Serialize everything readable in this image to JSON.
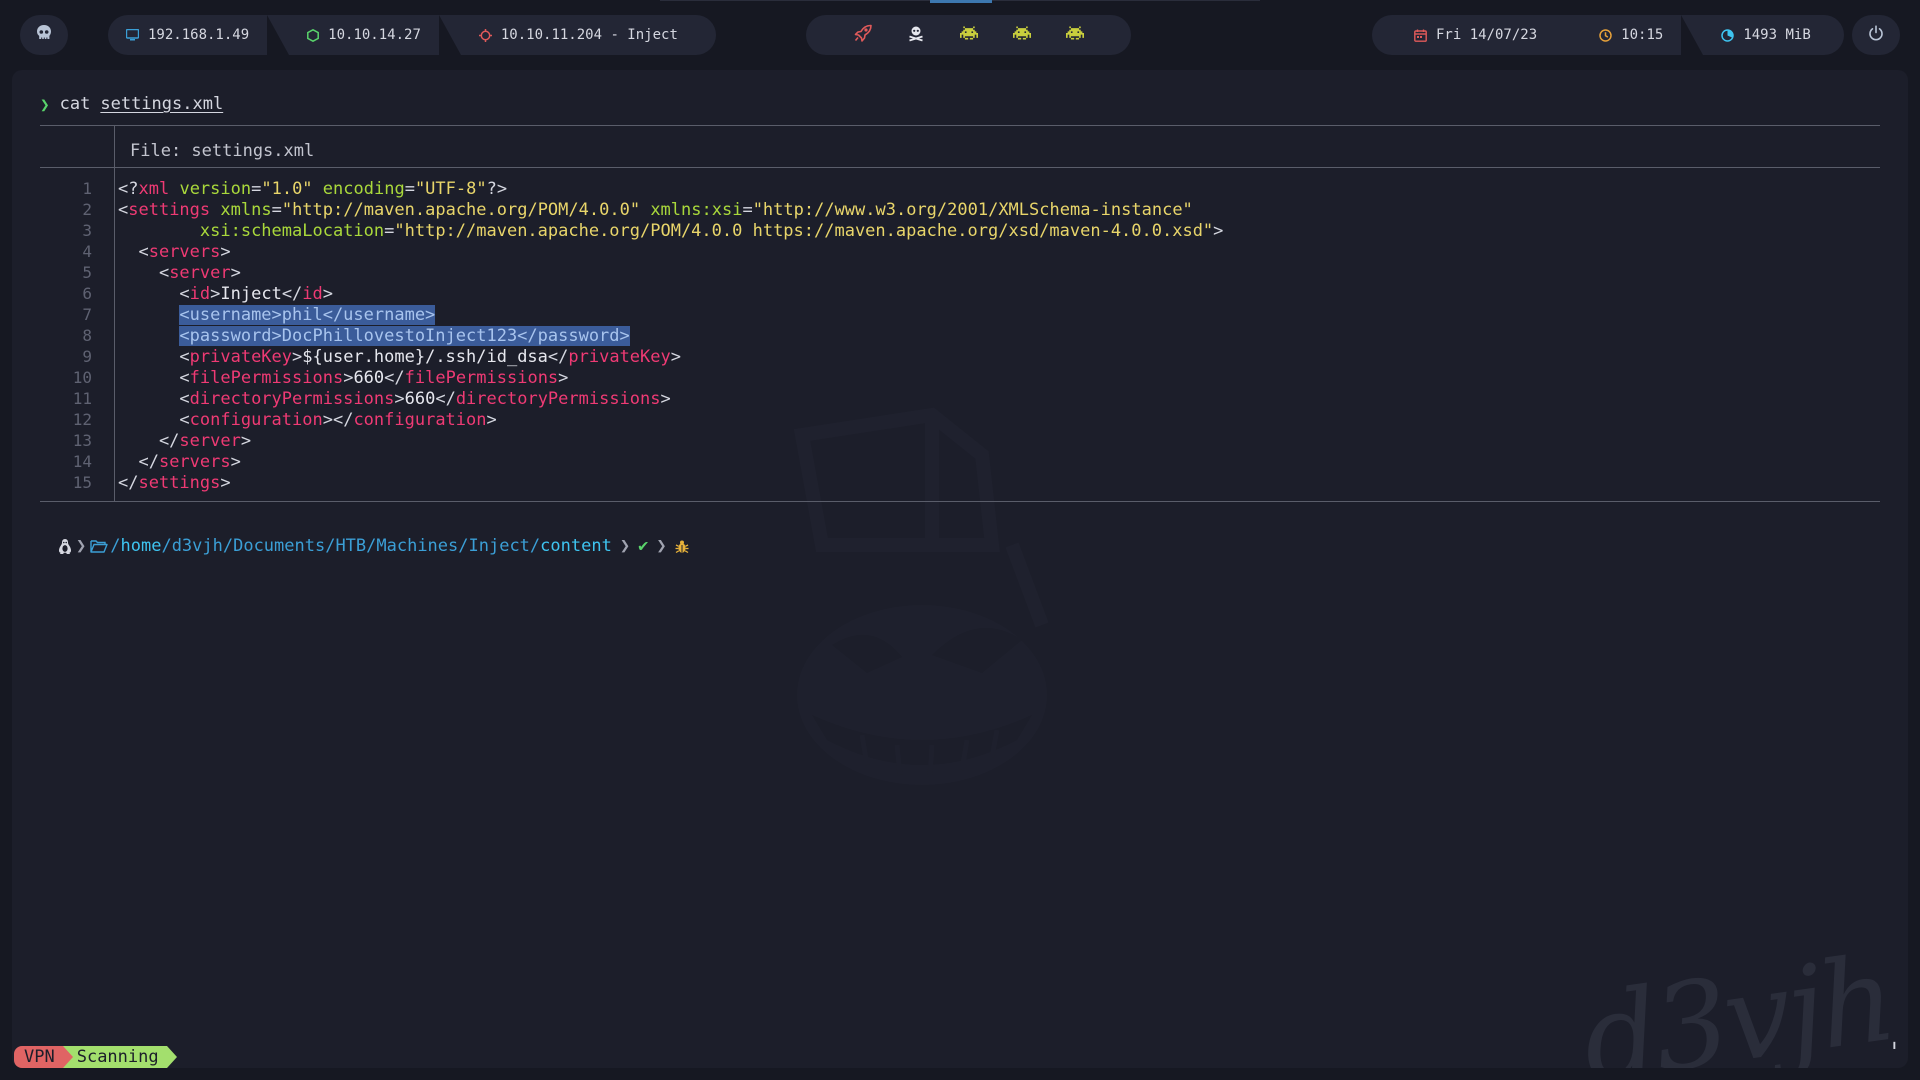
{
  "topbar": {
    "network": [
      {
        "icon": "monitor-icon",
        "label": "192.168.1.49",
        "color": "#3b9fd6"
      },
      {
        "icon": "hexagon-icon",
        "label": "10.10.14.27",
        "color": "#59d36b"
      },
      {
        "icon": "crosshair-icon",
        "label": "10.10.11.204 - Inject",
        "color": "#e05a5a"
      }
    ],
    "workspaces": [
      {
        "icon": "rocket-icon",
        "color": "#e05a5a"
      },
      {
        "icon": "skull-crossbones-icon",
        "color": "#e6e7ee"
      },
      {
        "icon": "space-invader-icon",
        "color": "#c9cf3d"
      },
      {
        "icon": "space-invader-icon",
        "color": "#c9cf3d"
      },
      {
        "icon": "space-invader-icon",
        "color": "#c9cf3d"
      }
    ],
    "info": [
      {
        "icon": "calendar-icon",
        "label": "Fri 14/07/23",
        "color": "#e05a5a"
      },
      {
        "icon": "clock-icon",
        "label": "10:15",
        "color": "#e6a13a"
      },
      {
        "icon": "memory-icon",
        "label": "1493 MiB",
        "color": "#3ec4f0"
      }
    ]
  },
  "terminal": {
    "command": {
      "name": "cat",
      "arg": "settings.xml"
    },
    "file_header": "File: settings.xml",
    "lines": [
      {
        "n": "1",
        "tokens": [
          [
            "t-pun",
            "<?"
          ],
          [
            "t-tag",
            "xml"
          ],
          [
            "t-pun",
            " "
          ],
          [
            "t-attr",
            "version"
          ],
          [
            "t-pun",
            "="
          ],
          [
            "t-str",
            "\"1.0\""
          ],
          [
            "t-pun",
            " "
          ],
          [
            "t-attr",
            "encoding"
          ],
          [
            "t-pun",
            "="
          ],
          [
            "t-str",
            "\"UTF-8\""
          ],
          [
            "t-pun",
            "?>"
          ]
        ]
      },
      {
        "n": "2",
        "tokens": [
          [
            "t-pun",
            "<"
          ],
          [
            "t-tag",
            "settings"
          ],
          [
            "t-pun",
            " "
          ],
          [
            "t-attr",
            "xmlns"
          ],
          [
            "t-pun",
            "="
          ],
          [
            "t-str",
            "\"http://maven.apache.org/POM/4.0.0\""
          ],
          [
            "t-pun",
            " "
          ],
          [
            "t-attr",
            "xmlns:xsi"
          ],
          [
            "t-pun",
            "="
          ],
          [
            "t-str",
            "\"http://www.w3.org/2001/XMLSchema-instance\""
          ]
        ]
      },
      {
        "n": "3",
        "tokens": [
          [
            "t-pun",
            "        "
          ],
          [
            "t-attr",
            "xsi:schemaLocation"
          ],
          [
            "t-pun",
            "="
          ],
          [
            "t-str",
            "\"http://maven.apache.org/POM/4.0.0 https://maven.apache.org/xsd/maven-4.0.0.xsd\""
          ],
          [
            "t-pun",
            ">"
          ]
        ]
      },
      {
        "n": "4",
        "tokens": [
          [
            "t-pun",
            "  <"
          ],
          [
            "t-tag",
            "servers"
          ],
          [
            "t-pun",
            ">"
          ]
        ]
      },
      {
        "n": "5",
        "tokens": [
          [
            "t-pun",
            "    <"
          ],
          [
            "t-tag",
            "server"
          ],
          [
            "t-pun",
            ">"
          ]
        ]
      },
      {
        "n": "6",
        "tokens": [
          [
            "t-pun",
            "      <"
          ],
          [
            "t-tag",
            "id"
          ],
          [
            "t-pun",
            ">"
          ],
          [
            "t-txt",
            "Inject"
          ],
          [
            "t-pun",
            "</"
          ],
          [
            "t-tag",
            "id"
          ],
          [
            "t-pun",
            ">"
          ]
        ]
      },
      {
        "n": "7",
        "tokens": [
          [
            "t-pun",
            "      "
          ],
          [
            "hl",
            "<username>phil</username>"
          ]
        ]
      },
      {
        "n": "8",
        "tokens": [
          [
            "t-pun",
            "      "
          ],
          [
            "hl",
            "<password>DocPhillovestoInject123</password>"
          ]
        ]
      },
      {
        "n": "9",
        "tokens": [
          [
            "t-pun",
            "      <"
          ],
          [
            "t-tag",
            "privateKey"
          ],
          [
            "t-pun",
            ">"
          ],
          [
            "t-txt",
            "${user.home}/.ssh/id_dsa"
          ],
          [
            "t-pun",
            "</"
          ],
          [
            "t-tag",
            "privateKey"
          ],
          [
            "t-pun",
            ">"
          ]
        ]
      },
      {
        "n": "10",
        "tokens": [
          [
            "t-pun",
            "      <"
          ],
          [
            "t-tag",
            "filePermissions"
          ],
          [
            "t-pun",
            ">"
          ],
          [
            "t-txt",
            "660"
          ],
          [
            "t-pun",
            "</"
          ],
          [
            "t-tag",
            "filePermissions"
          ],
          [
            "t-pun",
            ">"
          ]
        ]
      },
      {
        "n": "11",
        "tokens": [
          [
            "t-pun",
            "      <"
          ],
          [
            "t-tag",
            "directoryPermissions"
          ],
          [
            "t-pun",
            ">"
          ],
          [
            "t-txt",
            "660"
          ],
          [
            "t-pun",
            "</"
          ],
          [
            "t-tag",
            "directoryPermissions"
          ],
          [
            "t-pun",
            ">"
          ]
        ]
      },
      {
        "n": "12",
        "tokens": [
          [
            "t-pun",
            "      <"
          ],
          [
            "t-tag",
            "configuration"
          ],
          [
            "t-pun",
            "></"
          ],
          [
            "t-tag",
            "configuration"
          ],
          [
            "t-pun",
            ">"
          ]
        ]
      },
      {
        "n": "13",
        "tokens": [
          [
            "t-pun",
            "    </"
          ],
          [
            "t-tag",
            "server"
          ],
          [
            "t-pun",
            ">"
          ]
        ]
      },
      {
        "n": "14",
        "tokens": [
          [
            "t-pun",
            "  </"
          ],
          [
            "t-tag",
            "servers"
          ],
          [
            "t-pun",
            ">"
          ]
        ]
      },
      {
        "n": "15",
        "tokens": [
          [
            "t-pun",
            "</"
          ],
          [
            "t-tag",
            "settings"
          ],
          [
            "t-pun",
            ">"
          ]
        ]
      }
    ],
    "prompt": {
      "os_icon": "linux-tux-icon",
      "folder_icon": "folder-open-icon",
      "path_prefix": "/",
      "path_home": "home",
      "path_middle": "/d3vjh/Documents/HTB/Machines/Inject/",
      "path_last": "content",
      "check": "✔",
      "bug_icon": "bug-icon"
    },
    "watermark_text": "d3vjh"
  },
  "status": {
    "vpn": "VPN",
    "scan": "Scanning"
  }
}
